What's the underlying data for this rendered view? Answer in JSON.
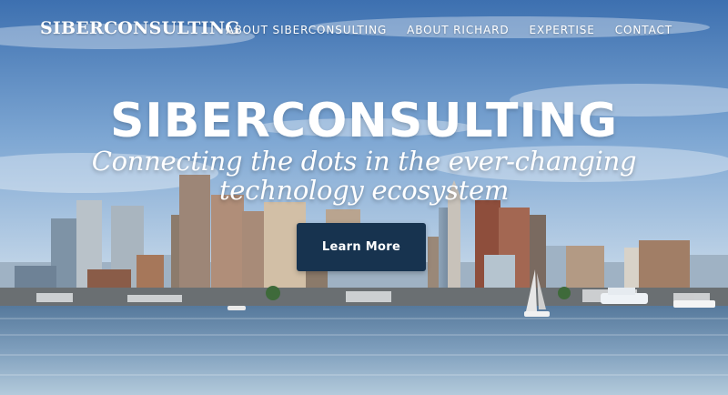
{
  "header": {
    "brand": "SIBERCONSULTING",
    "nav": [
      {
        "label": "ABOUT SIBERCONSULTING"
      },
      {
        "label": "ABOUT RICHARD"
      },
      {
        "label": "EXPERTISE"
      },
      {
        "label": "CONTACT"
      }
    ]
  },
  "hero": {
    "title": "SIBERCONSULTING",
    "tagline_line1": "Connecting the dots in the ever-changing",
    "tagline_line2": "technology ecosystem",
    "cta_label": "Learn More",
    "background_image": "city-skyline-harbor-photo"
  },
  "colors": {
    "sky_top": "#3f73b3",
    "sky_bottom": "#cfe0ef",
    "water_top": "#5f84a6",
    "water_bottom": "#a9c4d8",
    "cta_background": "#17334f",
    "text": "#ffffff"
  }
}
